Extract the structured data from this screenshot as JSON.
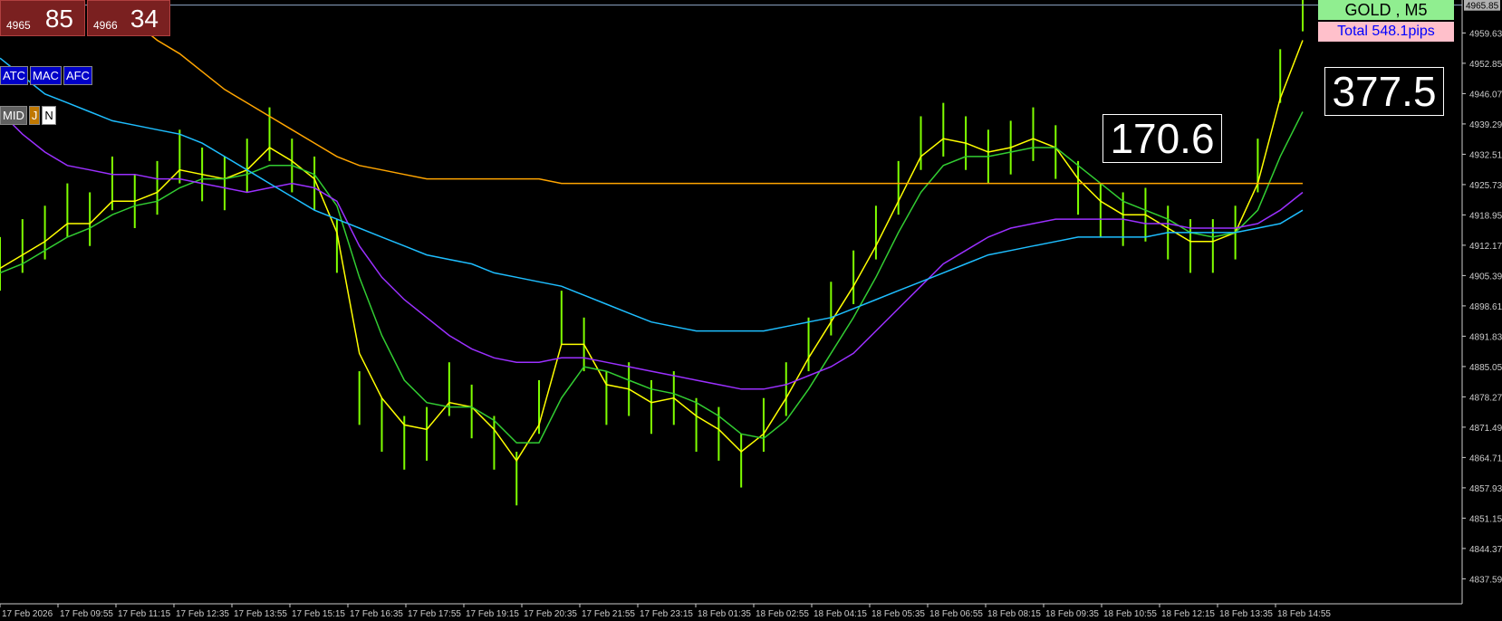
{
  "header": {
    "bid": {
      "prefix": "4965",
      "pips": "85"
    },
    "ask": {
      "prefix": "4966",
      "pips": "34"
    },
    "buttons_row1": [
      "ATC",
      "MAC",
      "AFC"
    ],
    "buttons_row2": [
      "MID",
      "J",
      "N"
    ],
    "symbol": "GOLD , M5",
    "total": "Total  548.1pips",
    "value_left": "170.6",
    "value_right": "377.5"
  },
  "colors": {
    "background": "#000000",
    "candles": "#7fff00",
    "fast_ma": "#ffff00",
    "slow_ma": "#32cd32",
    "ma_purple": "#9b30ff",
    "ma_blue": "#1ebeff",
    "ma_orange": "#ffa500",
    "current_price_line": "#8fa8c8",
    "price_tag": "#b0b0b0"
  },
  "chart_data": {
    "type": "line",
    "x_labels": [
      "17 Feb 2026",
      "17 Feb 09:55",
      "17 Feb 11:15",
      "17 Feb 12:35",
      "17 Feb 13:55",
      "17 Feb 15:15",
      "17 Feb 16:35",
      "17 Feb 17:55",
      "17 Feb 19:15",
      "17 Feb 20:35",
      "17 Feb 21:55",
      "17 Feb 23:15",
      "18 Feb 01:35",
      "18 Feb 02:55",
      "18 Feb 04:15",
      "18 Feb 05:35",
      "18 Feb 06:55",
      "18 Feb 08:15",
      "18 Feb 09:35",
      "18 Feb 10:55",
      "18 Feb 12:15",
      "18 Feb 13:35",
      "18 Feb 14:55"
    ],
    "y_ticks": [
      "4959.63",
      "4952.85",
      "4946.07",
      "4939.29",
      "4932.51",
      "4925.73",
      "4918.95",
      "4912.17",
      "4905.39",
      "4898.61",
      "4891.83",
      "4885.05",
      "4878.27",
      "4871.49",
      "4864.71",
      "4857.93",
      "4851.15",
      "4844.37",
      "4837.59"
    ],
    "ylim": [
      4832,
      4967
    ],
    "current_price": "4965.85",
    "series": [
      {
        "key": "price",
        "values": [
          4908,
          4912,
          4915,
          4920,
          4918,
          4926,
          4922,
          4925,
          4932,
          4928,
          4926,
          4930,
          4937,
          4930,
          4926,
          4912,
          4878,
          4872,
          4868,
          4870,
          4880,
          4875,
          4868,
          4860,
          4876,
          4896,
          4890,
          4878,
          4880,
          4876,
          4878,
          4872,
          4870,
          4864,
          4872,
          4880,
          4890,
          4898,
          4905,
          4915,
          4925,
          4935,
          4938,
          4935,
          4932,
          4934,
          4937,
          4933,
          4925,
          4920,
          4918,
          4919,
          4915,
          4912,
          4912,
          4915,
          4930,
          4950,
          4966
        ]
      },
      {
        "key": "fast_ma",
        "values": [
          4907,
          4910,
          4913,
          4917,
          4917,
          4922,
          4922,
          4924,
          4929,
          4928,
          4927,
          4929,
          4934,
          4931,
          4927,
          4915,
          4888,
          4878,
          4872,
          4871,
          4877,
          4876,
          4871,
          4864,
          4872,
          4890,
          4890,
          4881,
          4880,
          4877,
          4878,
          4874,
          4871,
          4866,
          4870,
          4878,
          4887,
          4895,
          4903,
          4912,
          4922,
          4932,
          4936,
          4935,
          4933,
          4934,
          4936,
          4934,
          4927,
          4922,
          4919,
          4919,
          4916,
          4913,
          4913,
          4915,
          4926,
          4945,
          4958
        ]
      },
      {
        "key": "slow_ma",
        "values": [
          4906,
          4908,
          4911,
          4914,
          4916,
          4919,
          4921,
          4922,
          4925,
          4927,
          4927,
          4928,
          4930,
          4930,
          4928,
          4921,
          4905,
          4892,
          4882,
          4877,
          4876,
          4876,
          4873,
          4868,
          4868,
          4878,
          4885,
          4884,
          4882,
          4880,
          4879,
          4877,
          4874,
          4870,
          4869,
          4873,
          4880,
          4888,
          4896,
          4905,
          4915,
          4924,
          4930,
          4932,
          4932,
          4933,
          4934,
          4934,
          4930,
          4926,
          4922,
          4920,
          4918,
          4915,
          4914,
          4915,
          4920,
          4932,
          4942
        ]
      },
      {
        "key": "ma_purple",
        "values": [
          4942,
          4937,
          4933,
          4930,
          4929,
          4928,
          4928,
          4927,
          4927,
          4926,
          4925,
          4924,
          4925,
          4926,
          4925,
          4922,
          4912,
          4905,
          4900,
          4896,
          4892,
          4889,
          4887,
          4886,
          4886,
          4887,
          4887,
          4886,
          4885,
          4884,
          4883,
          4882,
          4881,
          4880,
          4880,
          4881,
          4883,
          4885,
          4888,
          4893,
          4898,
          4903,
          4908,
          4911,
          4914,
          4916,
          4917,
          4918,
          4918,
          4918,
          4918,
          4917,
          4917,
          4916,
          4916,
          4916,
          4917,
          4920,
          4924
        ]
      },
      {
        "key": "ma_blue",
        "values": [
          4954,
          4950,
          4946,
          4944,
          4942,
          4940,
          4939,
          4938,
          4937,
          4935,
          4932,
          4929,
          4926,
          4923,
          4920,
          4918,
          4916,
          4914,
          4912,
          4910,
          4909,
          4908,
          4906,
          4905,
          4904,
          4903,
          4901,
          4899,
          4897,
          4895,
          4894,
          4893,
          4893,
          4893,
          4893,
          4894,
          4895,
          4896,
          4898,
          4900,
          4902,
          4904,
          4906,
          4908,
          4910,
          4911,
          4912,
          4913,
          4914,
          4914,
          4914,
          4914,
          4915,
          4915,
          4915,
          4915,
          4916,
          4917,
          4920
        ]
      },
      {
        "key": "ma_orange",
        "values": [
          4992,
          4985,
          4980,
          4974,
          4970,
          4965,
          4962,
          4958,
          4955,
          4951,
          4947,
          4944,
          4941,
          4938,
          4935,
          4932,
          4930,
          4929,
          4928,
          4927,
          4927,
          4927,
          4927,
          4927,
          4927,
          4926,
          4926,
          4926,
          4926,
          4926,
          4926,
          4926,
          4926,
          4926,
          4926,
          4926,
          4926,
          4926,
          4926,
          4926,
          4926,
          4926,
          4926,
          4926,
          4926,
          4926,
          4926,
          4926,
          4926,
          4926,
          4926,
          4926,
          4926,
          4926,
          4926,
          4926,
          4926,
          4926,
          4926
        ]
      }
    ]
  }
}
